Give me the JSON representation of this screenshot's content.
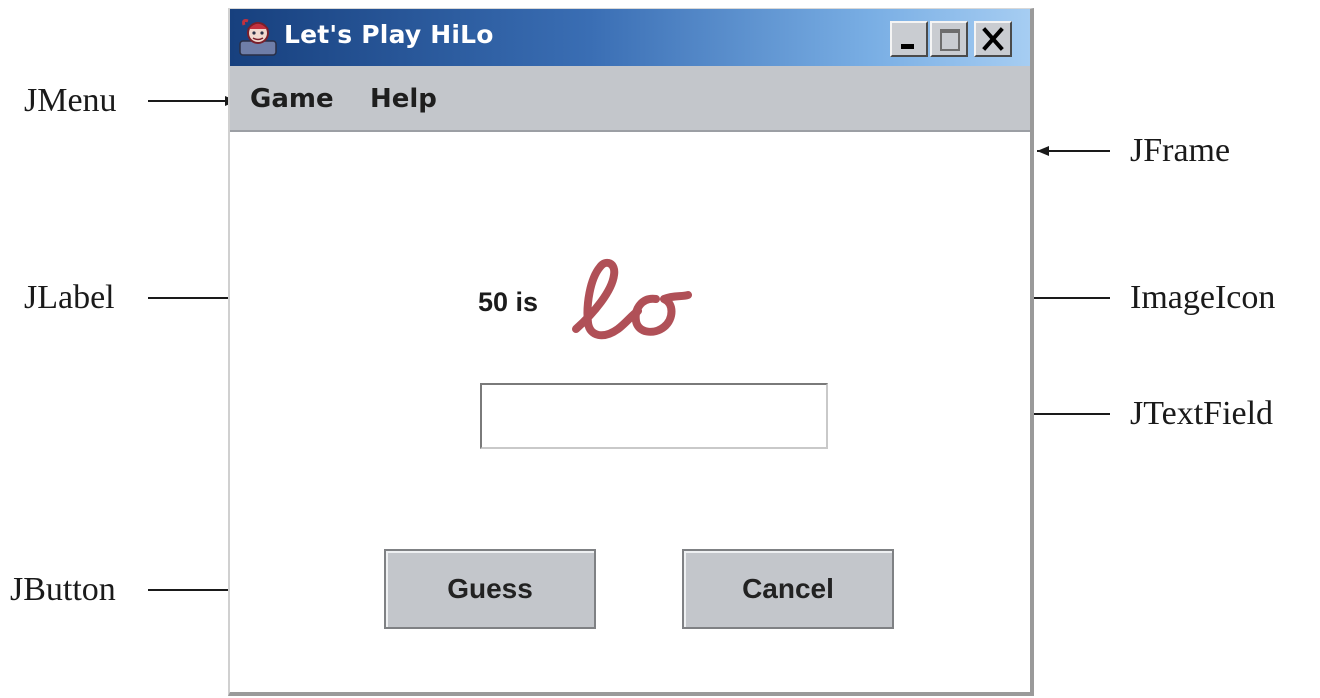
{
  "window": {
    "title": "Let's Play HiLo",
    "controls": [
      "minimize",
      "maximize",
      "close"
    ]
  },
  "menubar": {
    "items": [
      "Game",
      "Help"
    ]
  },
  "content": {
    "label": "50 is",
    "image_icon": {
      "name": "handwritten-lo-icon",
      "color": "#b05057"
    },
    "text_field": {
      "value": "",
      "placeholder": ""
    },
    "buttons": {
      "guess": "Guess",
      "cancel": "Cancel"
    }
  },
  "callouts": {
    "jmenu": "JMenu",
    "jframe": "JFrame",
    "jlabel": "JLabel",
    "imageicon": "ImageIcon",
    "jtextfield": "JTextField",
    "jbutton": "JButton"
  },
  "colors": {
    "title_gradient_start": "#17407e",
    "title_gradient_end": "#a6cdf2",
    "chrome_gray": "#c3c6cb",
    "icon_red": "#b05057"
  }
}
